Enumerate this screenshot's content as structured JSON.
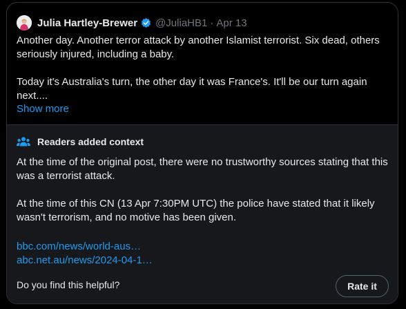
{
  "post": {
    "author_name": "Julia Hartley-Brewer",
    "handle": "@JuliaHB1",
    "separator": "·",
    "date": "Apr 13",
    "paragraph_1": "Another day. Another terror attack by another Islamist terrorist. Six dead, others seriously injured, including a baby.",
    "paragraph_2": "Today it's Australia's turn, the other day it was France's. It'll be our turn again next....",
    "show_more_label": "Show more",
    "verified_icon_color": "#1d9bf0"
  },
  "context": {
    "title": "Readers added context",
    "icon": "readers-icon",
    "paragraph_1": "At the time of the original post, there were no trustworthy sources stating that this was a terrorist attack.",
    "paragraph_2": "At the time of this CN (13 Apr 7:30PM UTC) the police have stated that it likely wasn't terrorism, and no motive has been given.",
    "links": [
      "bbc.com/news/world-aus…",
      "abc.net.au/news/2024-04-1…"
    ],
    "helpful_prompt": "Do you find this helpful?",
    "rate_button_label": "Rate it"
  },
  "colors": {
    "background": "#000000",
    "context_background": "#16181c",
    "link": "#1d9bf0",
    "text": "#e7e9ea",
    "muted": "#71767b",
    "border": "#2f3336",
    "avatar_outfit": "#d6336c"
  }
}
